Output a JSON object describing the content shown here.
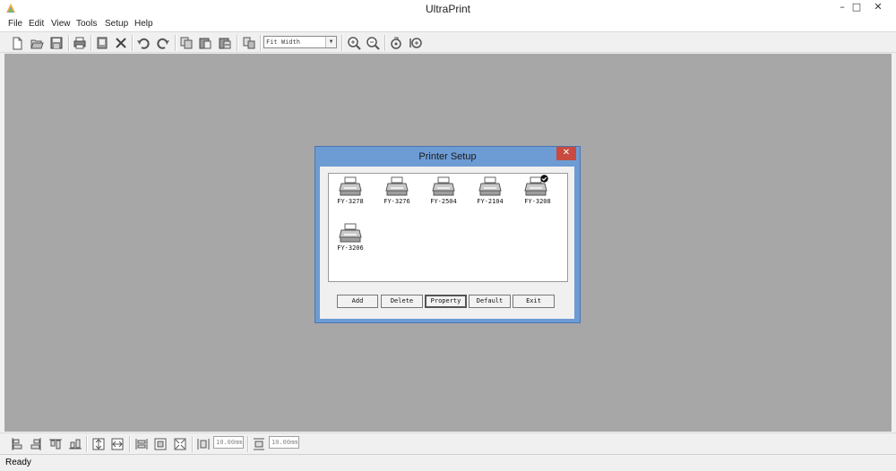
{
  "app": {
    "title": "UltraPrint"
  },
  "window_controls": {
    "minimize": "–",
    "maximize": "□",
    "close": "✕"
  },
  "menu": [
    "File",
    "Edit",
    "View",
    "Tools",
    "Setup",
    "Help"
  ],
  "toolbar": {
    "zoom_value": "Fit Width",
    "icons": [
      "new-file-icon",
      "open-folder-icon",
      "save-icon",
      "print-icon",
      "print-preview-icon",
      "delete-icon",
      "undo-icon",
      "redo-icon",
      "copy-icon",
      "paste-icon",
      "paste-special-icon",
      "refresh-icon",
      "zoom-in-icon",
      "zoom-out-icon",
      "rotate-icon",
      "fit-page-icon"
    ]
  },
  "bottom_toolbar": {
    "icons": [
      "align-left-icon",
      "align-right-icon",
      "align-top-icon",
      "align-bottom-icon",
      "center-vertical-icon",
      "center-horizontal-icon",
      "same-width-icon",
      "same-height-icon",
      "same-size-icon",
      "h-spacing-icon",
      "v-spacing-icon"
    ],
    "h_spacing": "10.00mm",
    "v_spacing": "10.00mm"
  },
  "status": "Ready",
  "dialog": {
    "title": "Printer Setup",
    "close_label": "✕",
    "printers": [
      {
        "name": "FY-3278",
        "default": false
      },
      {
        "name": "FY-3276",
        "default": false
      },
      {
        "name": "FY-2504",
        "default": false
      },
      {
        "name": "FY-2104",
        "default": false
      },
      {
        "name": "FY-3208",
        "default": true
      },
      {
        "name": "FY-3206",
        "default": false
      }
    ],
    "buttons": {
      "add": "Add",
      "delete": "Delete",
      "property": "Property",
      "default": "Default",
      "exit": "Exit"
    }
  },
  "colors": {
    "workspace": "#a7a7a7",
    "dialog_frame": "#6d9bd4",
    "close_button": "#c94a3f"
  }
}
